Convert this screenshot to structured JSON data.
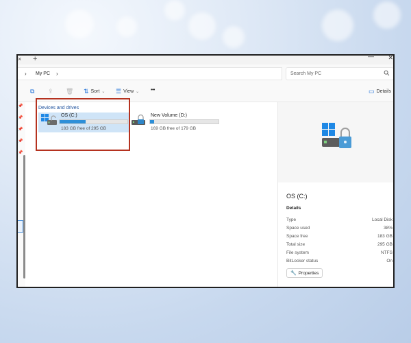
{
  "window": {
    "tab_close_glyph": "×",
    "new_tab_glyph": "+",
    "minimize_glyph": "—",
    "close_glyph": "✕"
  },
  "address": {
    "location": "My PC",
    "separator": "›",
    "search_placeholder": "Search My PC"
  },
  "toolbar": {
    "sort_label": "Sort",
    "view_label": "View",
    "more_label": "•••",
    "details_label": "Details"
  },
  "content": {
    "section_title": "Devices and drives",
    "drives": [
      {
        "name": "OS (C:)",
        "space": "183 GB free of 295 GB",
        "used_fraction": 0.38,
        "icon": "windows-drive-icon",
        "selected": true
      },
      {
        "name": "New Volume (D:)",
        "space": "169 GB free of 179 GB",
        "used_fraction": 0.06,
        "icon": "locked-drive-icon",
        "selected": false
      }
    ]
  },
  "details": {
    "title": "OS (C:)",
    "section": "Details",
    "rows": [
      {
        "label": "Type",
        "value": "Local Disk"
      },
      {
        "label": "Space used",
        "value": "38%"
      },
      {
        "label": "Space free",
        "value": "183 GB"
      },
      {
        "label": "Total size",
        "value": "295 GB"
      },
      {
        "label": "File system",
        "value": "NTFS"
      },
      {
        "label": "BitLocker status",
        "value": "On"
      }
    ],
    "properties_label": "Properties"
  },
  "colors": {
    "accent": "#2d8fd8",
    "selection": "#cfe4f7",
    "highlight_box": "#b5321f",
    "section_title": "#1b4f9c"
  }
}
